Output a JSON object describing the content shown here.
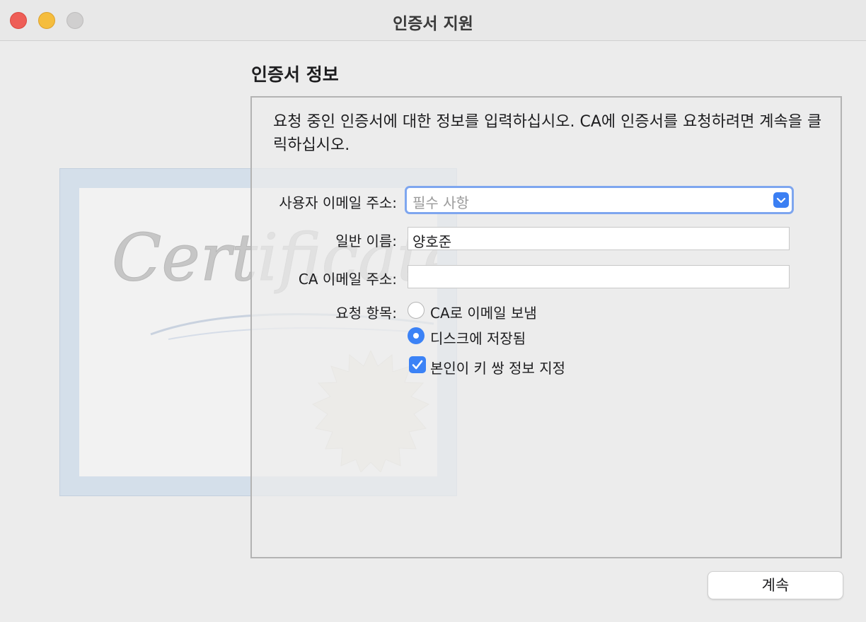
{
  "window": {
    "title": "인증서 지원"
  },
  "section": {
    "title": "인증서 정보",
    "description": "요청 중인 인증서에 대한 정보를 입력하십시오. CA에 인증서를 요청하려면 계속을 클릭하십시오."
  },
  "background_art": {
    "script_text": "Certificate"
  },
  "form": {
    "user_email": {
      "label": "사용자 이메일 주소:",
      "placeholder": "필수 사항",
      "value": ""
    },
    "common_name": {
      "label": "일반 이름:",
      "value": "양호준"
    },
    "ca_email": {
      "label": "CA 이메일 주소:",
      "value": ""
    },
    "request_type": {
      "label": "요청 항목:",
      "options": [
        {
          "label": "CA로 이메일 보냄",
          "selected": false
        },
        {
          "label": "디스크에 저장됨",
          "selected": true
        }
      ]
    },
    "key_pair_checkbox": {
      "label": "본인이 키 쌍 정보 지정",
      "checked": true
    }
  },
  "footer": {
    "continue_label": "계속"
  },
  "colors": {
    "accent": "#3b82f6",
    "focus_ring": "#7ea6ef",
    "close": "#ee5e57",
    "minimize": "#f5bd3d",
    "zoom_inactive": "#d0cfcf"
  }
}
